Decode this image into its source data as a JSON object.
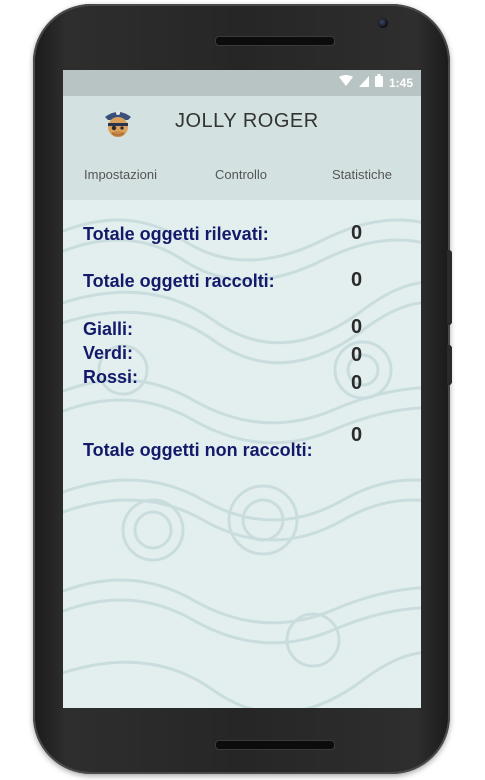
{
  "status_bar": {
    "time": "1:45"
  },
  "app": {
    "title": "JOLLY ROGER"
  },
  "tabs": [
    {
      "label": "Impostazioni"
    },
    {
      "label": "Controllo"
    },
    {
      "label": "Statistiche"
    }
  ],
  "stats": {
    "rilevati": {
      "label": "Totale oggetti rilevati:",
      "value": "0"
    },
    "raccolti": {
      "label": "Totale oggetti raccolti:",
      "value": "0"
    },
    "gialli": {
      "label": "Gialli:",
      "value": "0"
    },
    "verdi": {
      "label": "Verdi:",
      "value": "0"
    },
    "rossi": {
      "label": "Rossi:",
      "value": "0"
    },
    "non_raccolti": {
      "label": "Totale oggetti non raccolti:",
      "value": "0"
    }
  },
  "colors": {
    "app_bar": "#d3e2e1",
    "label_text": "#141a6a",
    "value_text": "#2b2b2b",
    "background_pattern": "#c9dfe0"
  },
  "icons": [
    "wifi-icon",
    "signal-icon",
    "battery-icon",
    "pirate-logo-icon"
  ]
}
